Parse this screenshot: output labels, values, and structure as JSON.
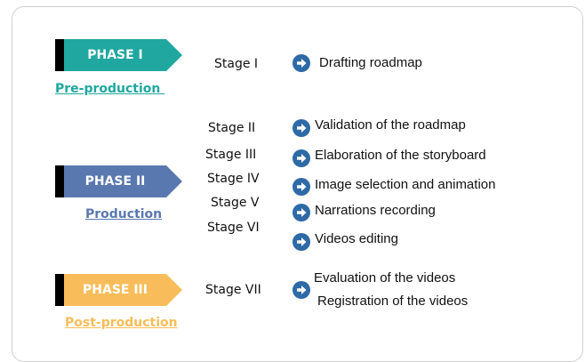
{
  "phases": [
    {
      "title": "PHASE I",
      "subtitle": "Pre-production ",
      "color": "#1fa7a0"
    },
    {
      "title": "PHASE II",
      "subtitle": "Production",
      "color": "#5a78b0"
    },
    {
      "title": "PHASE III",
      "subtitle": "Post-production",
      "color": "#f8bd5a"
    }
  ],
  "arrow_color": "#2d6aa6",
  "stages": [
    {
      "label": "Stage I",
      "tasks": [
        "Drafting roadmap"
      ]
    },
    {
      "label": "Stage  II",
      "tasks": [
        "Validation of the roadmap"
      ]
    },
    {
      "label": "Stage  III",
      "tasks": [
        "Elaboration of the storyboard"
      ]
    },
    {
      "label": "Stage  IV",
      "tasks": [
        "Image selection and animation"
      ]
    },
    {
      "label": "Stage  V",
      "tasks": [
        "Narrations recording"
      ]
    },
    {
      "label": "Stage  VI",
      "tasks": [
        "Videos editing"
      ]
    },
    {
      "label": "Stage VII",
      "tasks": [
        "Evaluation of the videos",
        "Registration of the videos"
      ]
    }
  ]
}
